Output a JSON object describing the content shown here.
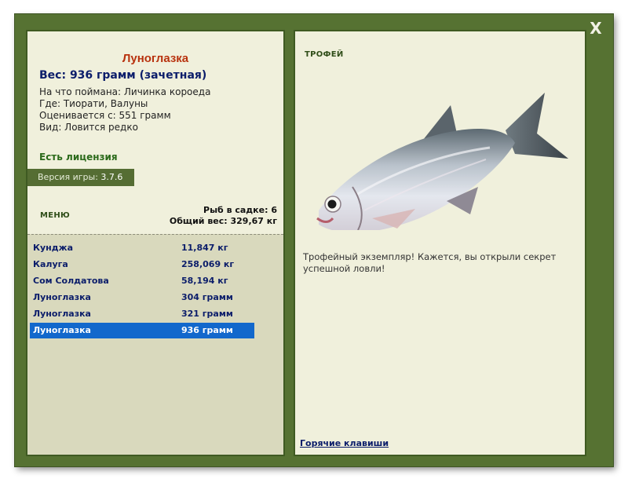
{
  "window": {
    "close_label": "X"
  },
  "fish": {
    "title": "Луноглазка",
    "weight": "Вес: 936 грамм (зачетная)",
    "info": [
      "На что поймана: Личинка короеда",
      "Где: Тиорати, Валуны",
      "Оценивается с: 551 грамм",
      "Вид: Ловится редко"
    ]
  },
  "license": "Есть лицензия",
  "version": {
    "label": "Версия игры:",
    "value": "3.7.6"
  },
  "menu_label": "МЕНЮ",
  "stats": {
    "in_keepnet": "Рыб в садке: 6",
    "total_weight": "Общий вес: 329,67 кг"
  },
  "catch_list": [
    {
      "name": "Кунджа",
      "weight": "11,847 кг"
    },
    {
      "name": "Калуга",
      "weight": "258,069 кг"
    },
    {
      "name": "Сом Солдатова",
      "weight": "58,194 кг"
    },
    {
      "name": "Луноглазка",
      "weight": "304 грамм"
    },
    {
      "name": "Луноглазка",
      "weight": "321 грамм"
    },
    {
      "name": "Луноглазка",
      "weight": "936 грамм",
      "selected": true
    }
  ],
  "trophy": {
    "label": "ТРОФЕЙ",
    "text": "Трофейный экземпляр! Кажется, вы открыли секрет успешной ловли!"
  },
  "hotkeys_link": "Горячие клавиши",
  "colors": {
    "frame": "#567232",
    "panel": "#f0f0dc",
    "list_bg": "#d9d9bd",
    "selected_row": "#1268cc",
    "title_red": "#b8320e",
    "text_navy": "#0b1d6a"
  }
}
